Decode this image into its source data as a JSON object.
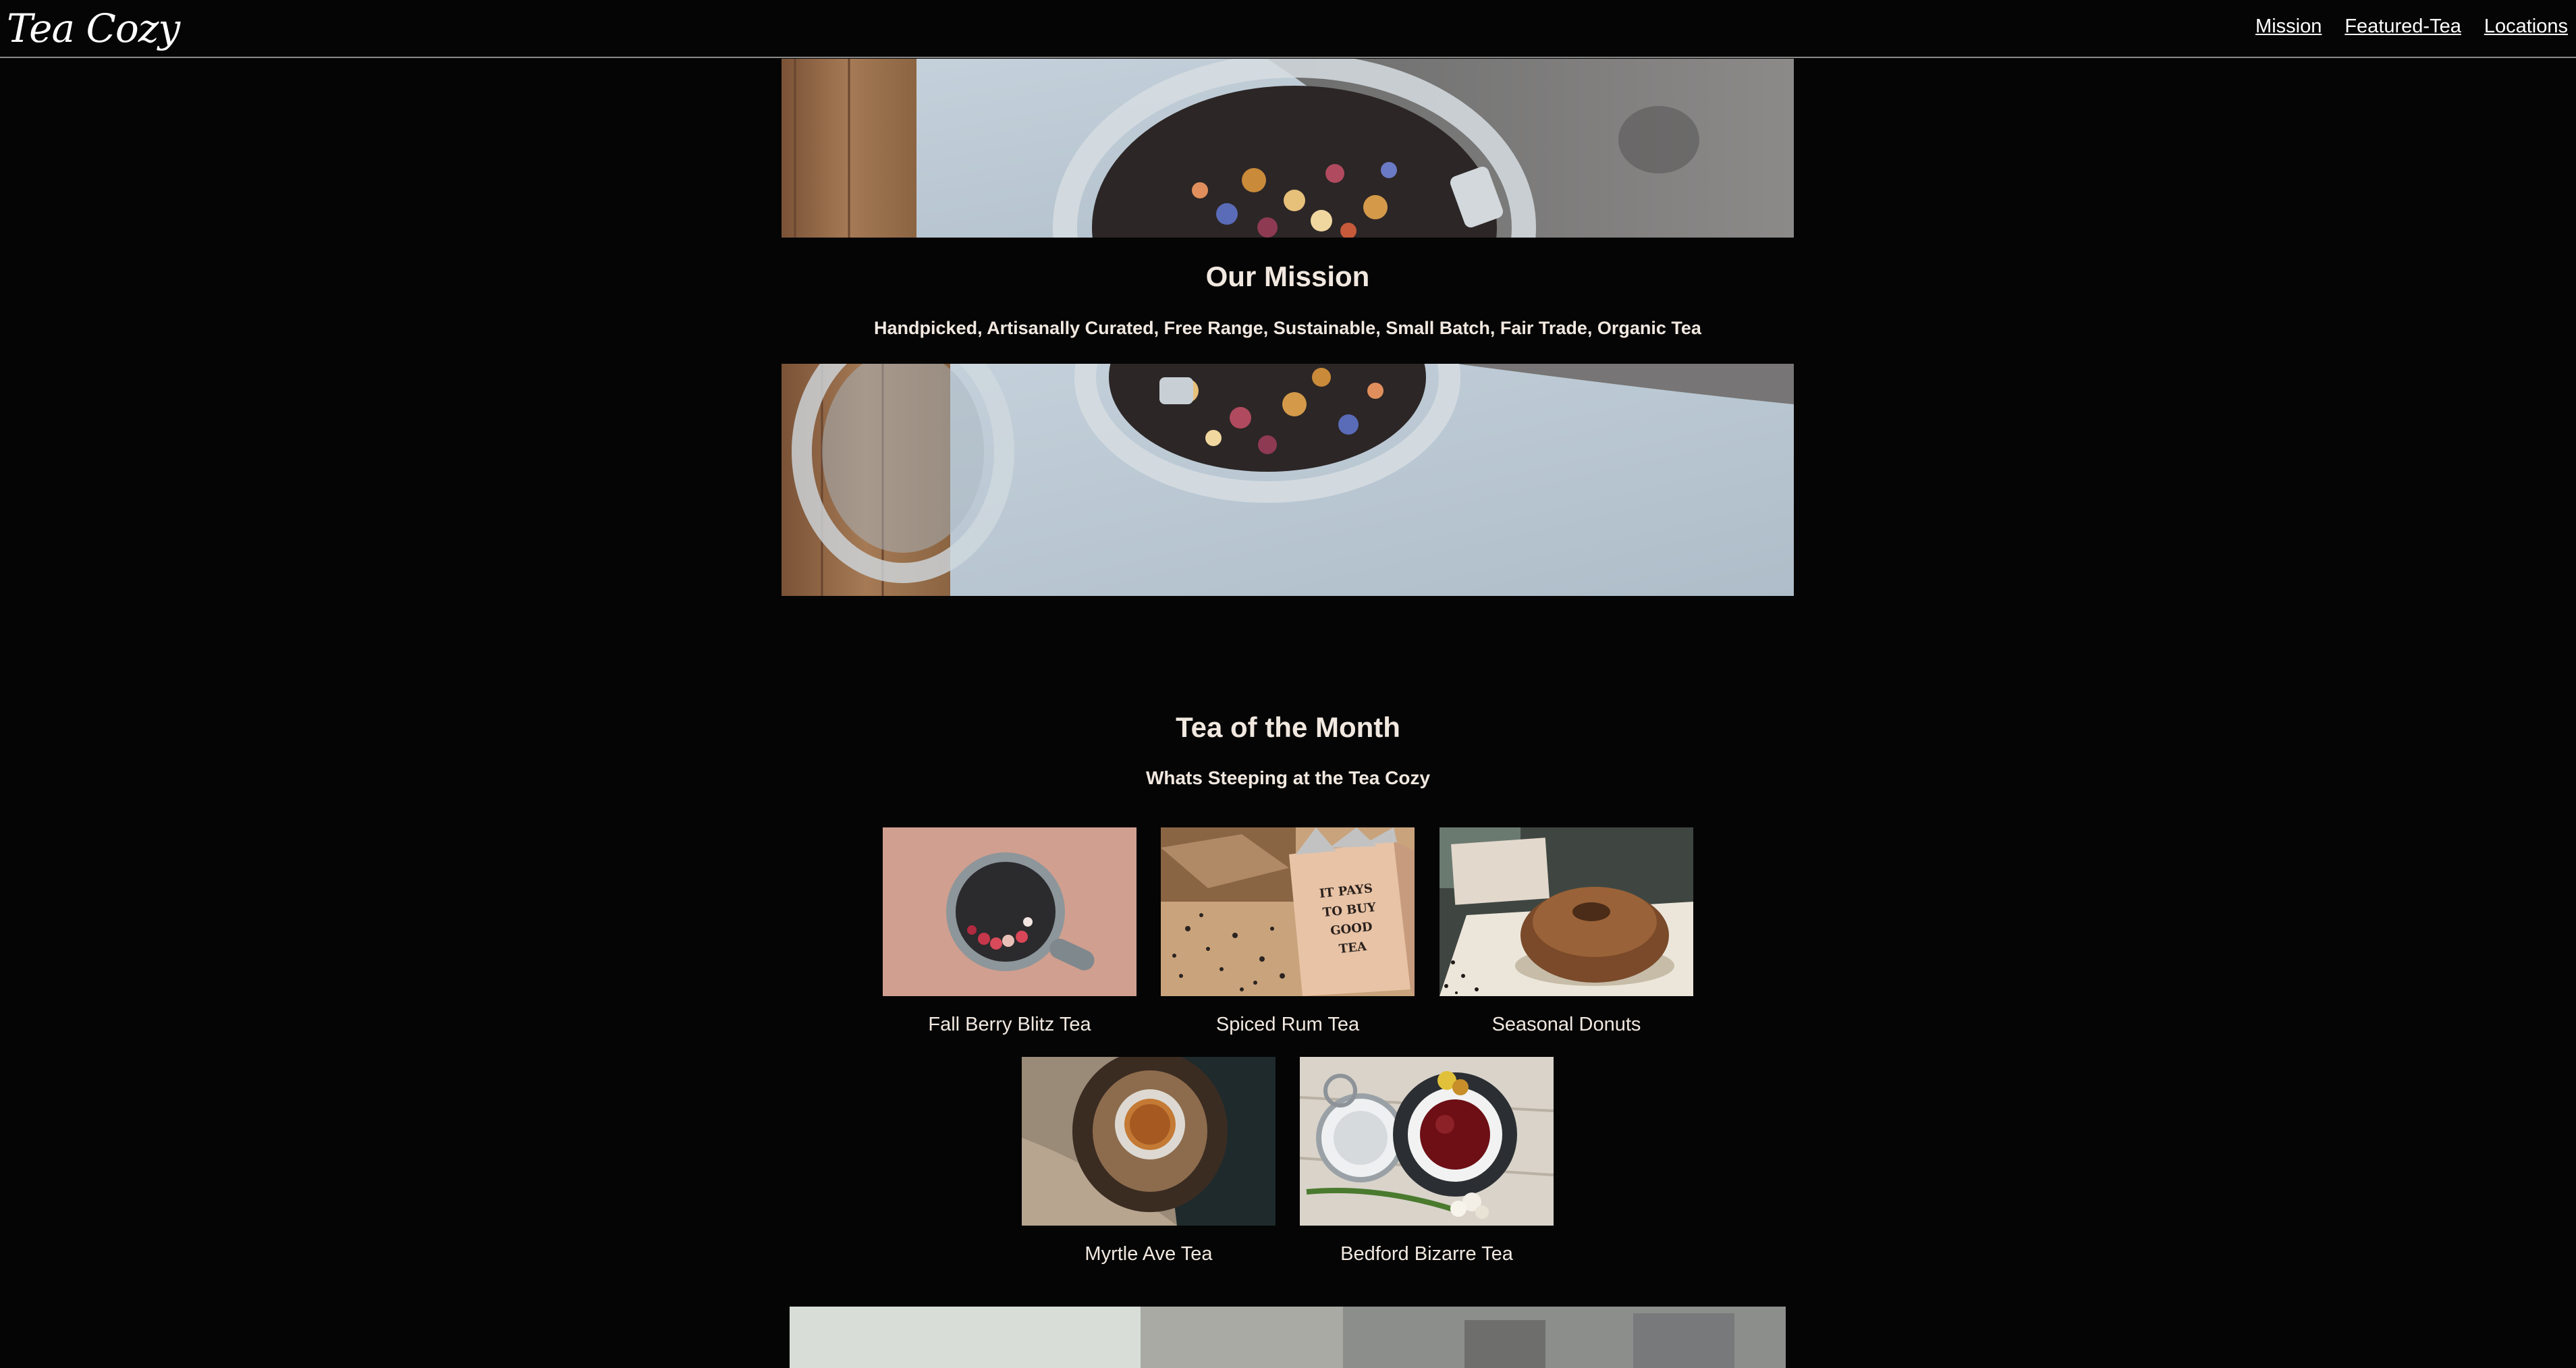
{
  "header": {
    "logo": "Tea Cozy",
    "nav": [
      "Mission",
      "Featured-Tea",
      "Locations"
    ]
  },
  "mission": {
    "title": "Our Mission",
    "subtitle": "Handpicked, Artisanally Curated, Free Range, Sustainable, Small Batch, Fair Trade, Organic Tea"
  },
  "tea_of_month": {
    "title": "Tea of the Month",
    "subtitle": "Whats Steeping at the Tea Cozy",
    "items": [
      {
        "name": "Fall Berry Blitz Tea",
        "icon": "berry-tea-image"
      },
      {
        "name": "Spiced Rum Tea",
        "icon": "spiced-rum-tea-image"
      },
      {
        "name": "Seasonal Donuts",
        "icon": "donut-image"
      },
      {
        "name": "Myrtle Ave Tea",
        "icon": "myrtle-tea-image"
      },
      {
        "name": "Bedford Bizarre Tea",
        "icon": "bedford-tea-image"
      }
    ],
    "box_text": "IT PAYS TO BUY GOOD TEA"
  },
  "colors": {
    "background": "#050505",
    "text": "#f1e8e0",
    "nav_link": "#ffffff"
  }
}
